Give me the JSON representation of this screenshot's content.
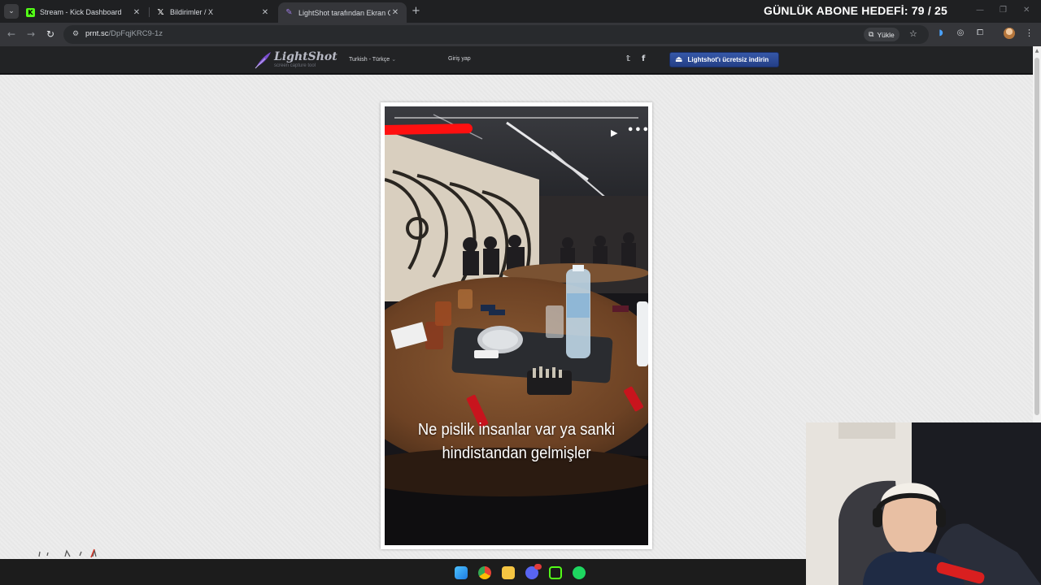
{
  "browser": {
    "tab_list_glyph": "⌄",
    "tabs": [
      {
        "label": "Stream - Kick Dashboard",
        "favicon": "K",
        "icon": "kick-icon",
        "color": "#53fc18"
      },
      {
        "label": "Bildirimler / X",
        "favicon": "𝕏",
        "icon": "x-icon",
        "color": "#ffffff"
      },
      {
        "label": "LightShot tarafından Ekran Gör",
        "favicon": "✎",
        "icon": "lightshot-icon",
        "color": "#8b5cf6"
      }
    ],
    "close_glyph": "✕",
    "new_tab_glyph": "+",
    "url_host": "prnt.sc",
    "url_path": "/DpFqjKRC9-1z",
    "install_label": "Yükle",
    "window_controls": [
      "—",
      "❐",
      "✕"
    ]
  },
  "overlay": {
    "goal_text": "GÜNLÜK ABONE HEDEFİ: 79 / 25"
  },
  "site": {
    "brand": "LightShot",
    "tagline": "screen capture tool",
    "language": "Turkish - Türkçe",
    "login": "Giriş yap",
    "social": [
      "twitter-icon",
      "facebook-icon"
    ],
    "twitter_glyph": "𝕥",
    "facebook_glyph": "f",
    "download_label": "Lightshot'ı ücretsiz indirin"
  },
  "screenshot": {
    "caption_line1": "Ne pislik insanlar var ya sanki",
    "caption_line2": "hindistandan gelmişler",
    "play_glyph": "▶",
    "more_glyph": "•••"
  },
  "taskbar": {
    "apps": [
      {
        "name": "start-icon",
        "color": "#3aa0f0"
      },
      {
        "name": "chrome-icon",
        "color": "#e94235"
      },
      {
        "name": "file-explorer-icon",
        "color": "#f5c542"
      },
      {
        "name": "discord-icon",
        "color": "#5865f2"
      },
      {
        "name": "kick-app-icon",
        "color": "#53fc18"
      },
      {
        "name": "spotify-icon",
        "color": "#1ed760"
      }
    ]
  },
  "colors": {
    "accent": "#2b4a9a",
    "page_bg": "#ececec",
    "redaction": "#ff1010"
  }
}
